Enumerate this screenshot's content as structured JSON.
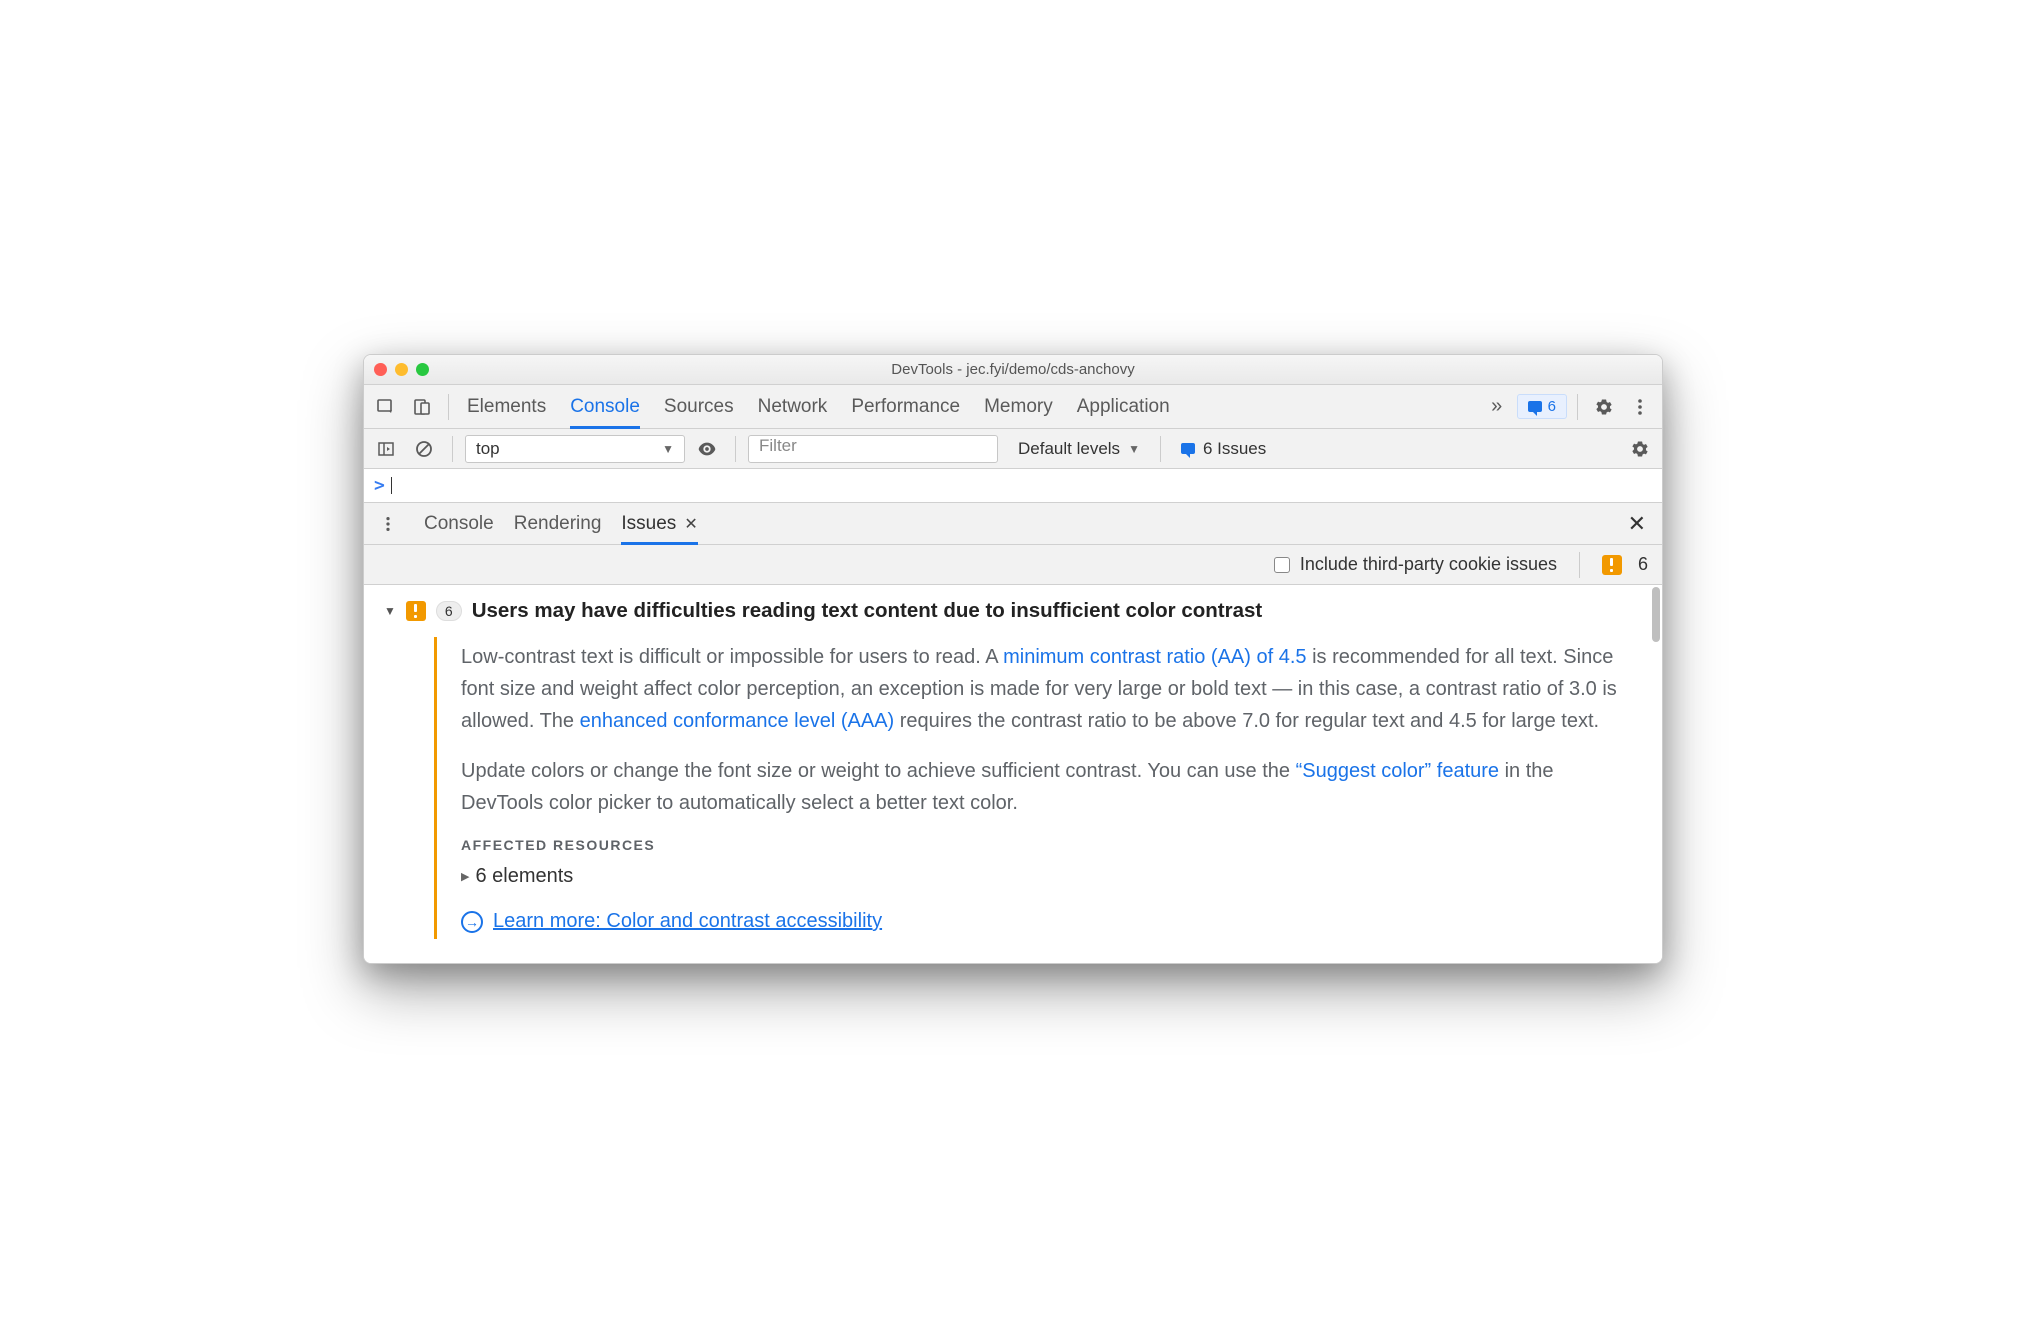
{
  "window_title": "DevTools - jec.fyi/demo/cds-anchovy",
  "main_tabs": [
    "Elements",
    "Console",
    "Sources",
    "Network",
    "Performance",
    "Memory",
    "Application"
  ],
  "main_tab_active": "Console",
  "issues_badge_count": "6",
  "console": {
    "context": "top",
    "filter_placeholder": "Filter",
    "levels_label": "Default levels",
    "issues_label": "6 Issues"
  },
  "drawer_tabs": [
    "Console",
    "Rendering",
    "Issues"
  ],
  "drawer_tab_active": "Issues",
  "subbar": {
    "checkbox_label": "Include third-party cookie issues",
    "count": "6"
  },
  "issue": {
    "count": "6",
    "title": "Users may have difficulties reading text content due to insufficient color contrast",
    "p1_a": "Low-contrast text is difficult or impossible for users to read. A ",
    "p1_link1": "minimum contrast ratio (AA) of 4.5",
    "p1_b": " is recommended for all text. Since font size and weight affect color perception, an exception is made for very large or bold text — in this case, a contrast ratio of 3.0 is allowed. The ",
    "p1_link2": "enhanced conformance level (AAA)",
    "p1_c": " requires the contrast ratio to be above 7.0 for regular text and 4.5 for large text.",
    "p2_a": "Update colors or change the font size or weight to achieve sufficient contrast. You can use the ",
    "p2_link": "“Suggest color” feature",
    "p2_b": " in the DevTools color picker to automatically select a better text color.",
    "affected_heading": "AFFECTED RESOURCES",
    "affected_item": "6 elements",
    "learn_more": "Learn more: Color and contrast accessibility"
  }
}
